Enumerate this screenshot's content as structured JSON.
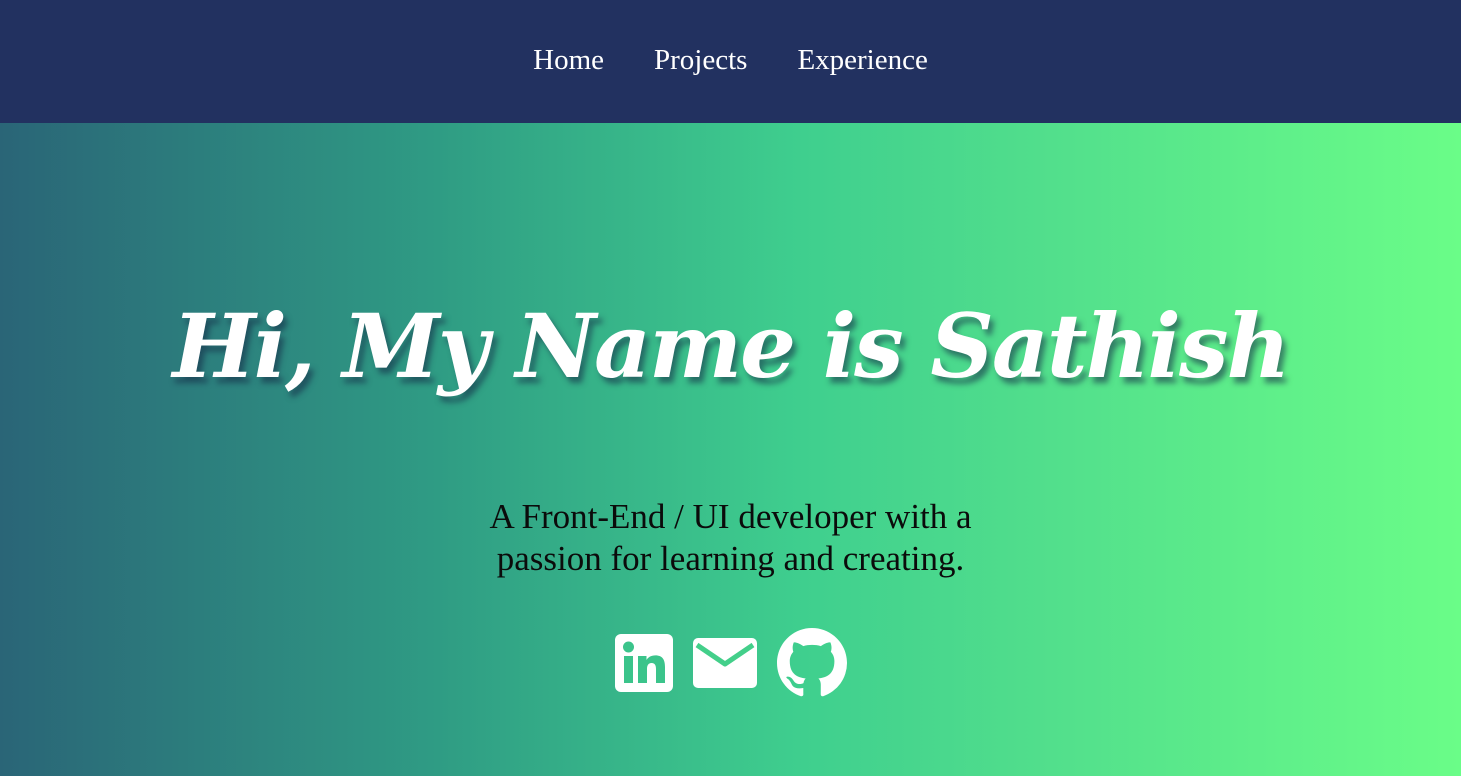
{
  "nav": {
    "items": [
      {
        "label": "Home"
      },
      {
        "label": "Projects"
      },
      {
        "label": "Experience"
      }
    ]
  },
  "hero": {
    "title": "Hi, My Name is Sathish",
    "subtitle": "A Front-End / UI developer with a passion for learning and creating.",
    "social": [
      {
        "icon": "linkedin-icon"
      },
      {
        "icon": "mail-icon"
      },
      {
        "icon": "github-icon"
      }
    ]
  },
  "colors": {
    "navbar": "#223160",
    "gradient_start": "#2a6577",
    "gradient_end": "#6afd88",
    "title_text": "#ffffff",
    "subtitle_text": "#0b0b0b"
  }
}
